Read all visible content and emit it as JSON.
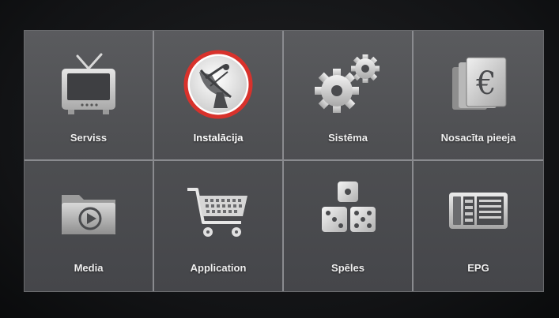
{
  "menu": {
    "items": [
      {
        "label": "Serviss",
        "icon": "tv-icon"
      },
      {
        "label": "Instalācija",
        "icon": "satellite-dish-icon",
        "selected": true
      },
      {
        "label": "Sistēma",
        "icon": "gears-icon"
      },
      {
        "label": "Nosacīta pieeja",
        "icon": "euro-cards-icon"
      },
      {
        "label": "Media",
        "icon": "media-folder-icon"
      },
      {
        "label": "Application",
        "icon": "shopping-cart-icon"
      },
      {
        "label": "Spēles",
        "icon": "dice-icon"
      },
      {
        "label": "EPG",
        "icon": "epg-guide-icon"
      }
    ]
  },
  "colors": {
    "selection_ring": "#d8322c",
    "panel": "#55565a",
    "grid_line": "#8a8b8f"
  }
}
